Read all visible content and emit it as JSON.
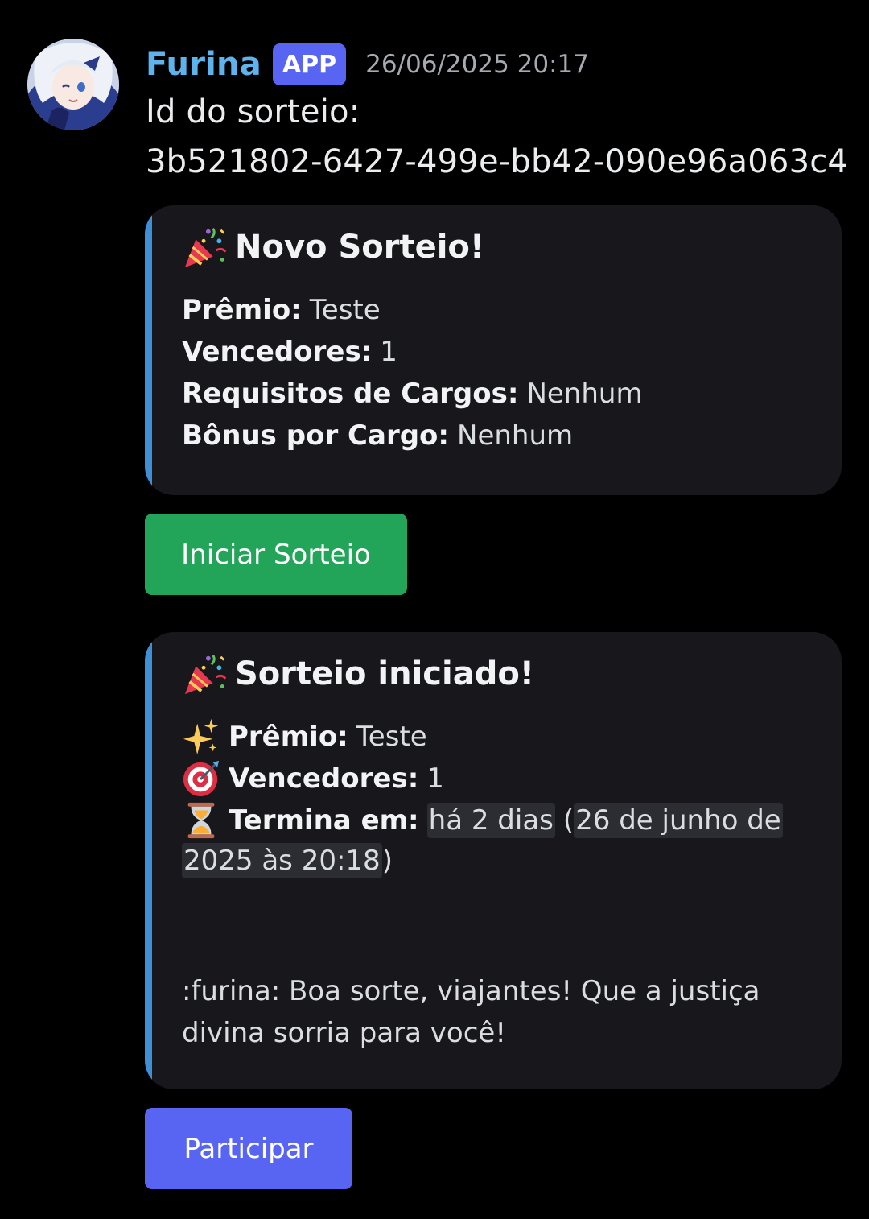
{
  "author": {
    "username": "Furina",
    "badge": "APP",
    "timestamp": "26/06/2025 20:17"
  },
  "message": {
    "line1": "Id do sorteio:",
    "line2": "3b521802-6427-499e-bb42-090e96a063c4"
  },
  "embed_new": {
    "accent_color": "#3e8fd5",
    "title": "Novo Sorteio!",
    "title_icon": "party-popper-icon",
    "fields": [
      {
        "label": "Prêmio:",
        "value": "Teste"
      },
      {
        "label": "Vencedores:",
        "value": "1"
      },
      {
        "label": "Requisitos de Cargos:",
        "value": "Nenhum"
      },
      {
        "label": "Bônus por Cargo:",
        "value": "Nenhum"
      }
    ]
  },
  "button_start": {
    "label": "Iniciar Sorteio",
    "color": "#23a559"
  },
  "embed_started": {
    "accent_color": "#3e8fd5",
    "title": "Sorteio iniciado!",
    "title_icon": "party-popper-icon",
    "prize_icon": "sparkles-icon",
    "prize_label": "Prêmio:",
    "prize_value": "Teste",
    "winners_icon": "direct-hit-target-icon",
    "winners_label": "Vencedores:",
    "winners_value": "1",
    "ends_icon": "hourglass-icon",
    "ends_label": "Termina em:",
    "ends_relative": "há 2 dias",
    "ends_paren_open": "(",
    "ends_absolute_part1": "26 de junho de",
    "ends_absolute_part2": "2025 às 20:18",
    "ends_paren_close": ")",
    "footer": ":furina: Boa sorte, viajantes! Que a justiça divina sorria para você!"
  },
  "button_join": {
    "label": "Participar",
    "color": "#5865f2"
  }
}
